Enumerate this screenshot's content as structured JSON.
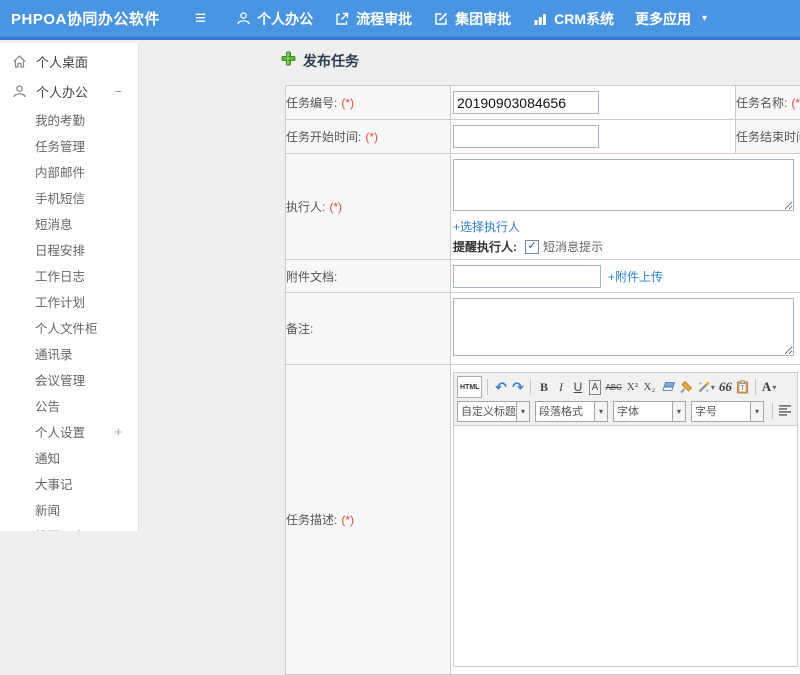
{
  "colors": {
    "header_bg": "#4a95e2",
    "header_border": "#3377cd",
    "link_blue": "#2e7fd0",
    "required_red": "#e14b45",
    "title_navy": "#2c3e50",
    "plus_green": "#62b53a"
  },
  "header": {
    "logo": "PHPOA协同办公软件",
    "nav": [
      {
        "name": "nav-personal-office",
        "icon": "person-icon",
        "label": "个人办公"
      },
      {
        "name": "nav-process-approval",
        "icon": "workflow-icon",
        "label": "流程审批"
      },
      {
        "name": "nav-group-approval",
        "icon": "edit-icon",
        "label": "集团审批"
      },
      {
        "name": "nav-crm-system",
        "icon": "chart-icon",
        "label": "CRM系统"
      },
      {
        "name": "nav-more-apps",
        "icon": "",
        "label": "更多应用",
        "caret": true
      }
    ]
  },
  "sidebar": {
    "items": [
      {
        "name": "personal-desktop",
        "label": "个人桌面",
        "icon": "home-icon",
        "level": 0
      },
      {
        "name": "personal-office",
        "label": "个人办公",
        "icon": "person-icon",
        "level": 0,
        "toggle": "−"
      },
      {
        "name": "my-attendance",
        "label": "我的考勤",
        "level": 1
      },
      {
        "name": "task-management",
        "label": "任务管理",
        "level": 1
      },
      {
        "name": "internal-mail",
        "label": "内部邮件",
        "level": 1
      },
      {
        "name": "mobile-sms",
        "label": "手机短信",
        "level": 1
      },
      {
        "name": "short-message",
        "label": "短消息",
        "level": 1
      },
      {
        "name": "schedule",
        "label": "日程安排",
        "level": 1
      },
      {
        "name": "work-log",
        "label": "工作日志",
        "level": 1
      },
      {
        "name": "work-plan",
        "label": "工作计划",
        "level": 1
      },
      {
        "name": "personal-file-cabinet",
        "label": "个人文件柜",
        "level": 1
      },
      {
        "name": "contacts",
        "label": "通讯录",
        "level": 1
      },
      {
        "name": "meeting-management",
        "label": "会议管理",
        "level": 1
      },
      {
        "name": "announcement",
        "label": "公告",
        "level": 1
      },
      {
        "name": "personal-settings",
        "label": "个人设置",
        "level": 1,
        "toggle": "+"
      },
      {
        "name": "notification",
        "label": "通知",
        "level": 1
      },
      {
        "name": "memorabilia",
        "label": "大事记",
        "level": 1
      },
      {
        "name": "news",
        "label": "新闻",
        "level": 1
      },
      {
        "name": "vote-survey",
        "label": "投票调查",
        "level": 1
      }
    ]
  },
  "page": {
    "title": "发布任务"
  },
  "form": {
    "task_no_label": "任务编号:",
    "task_no_req": "(*)",
    "task_no_value": "20190903084656",
    "task_name_label": "任务名称:",
    "task_name_req": "(*)",
    "start_label": "任务开始时间:",
    "start_req": "(*)",
    "end_label": "任务结束时间:",
    "end_req": "(*)",
    "executor_label": "执行人:",
    "executor_req": "(*)",
    "choose_executor_link": "+选择执行人",
    "remind_label": "提醒执行人:",
    "sms_checkbox_label": "短消息提示",
    "attachment_label": "附件文档:",
    "attachment_upload_link": "+附件上传",
    "remark_label": "备注:",
    "desc_label": "任务描述:",
    "desc_req": "(*)"
  },
  "editor": {
    "source_label": "HTML",
    "dropdowns": [
      "自定义标题",
      "段落格式",
      "字体",
      "字号"
    ]
  },
  "icons": {
    "hamburger-icon": "≡",
    "caret-down-icon": "▾",
    "undo-icon": "↶",
    "redo-icon": "↷",
    "bold-icon": "B",
    "italic-icon": "I",
    "underline-icon": "U",
    "font-style-icon": "A",
    "strikethrough-icon": "ABC",
    "superscript-icon": "X²",
    "subscript-icon": "X₂",
    "blockquote-icon": "66",
    "font-color-icon": "A",
    "checkbox-check": "✓"
  }
}
